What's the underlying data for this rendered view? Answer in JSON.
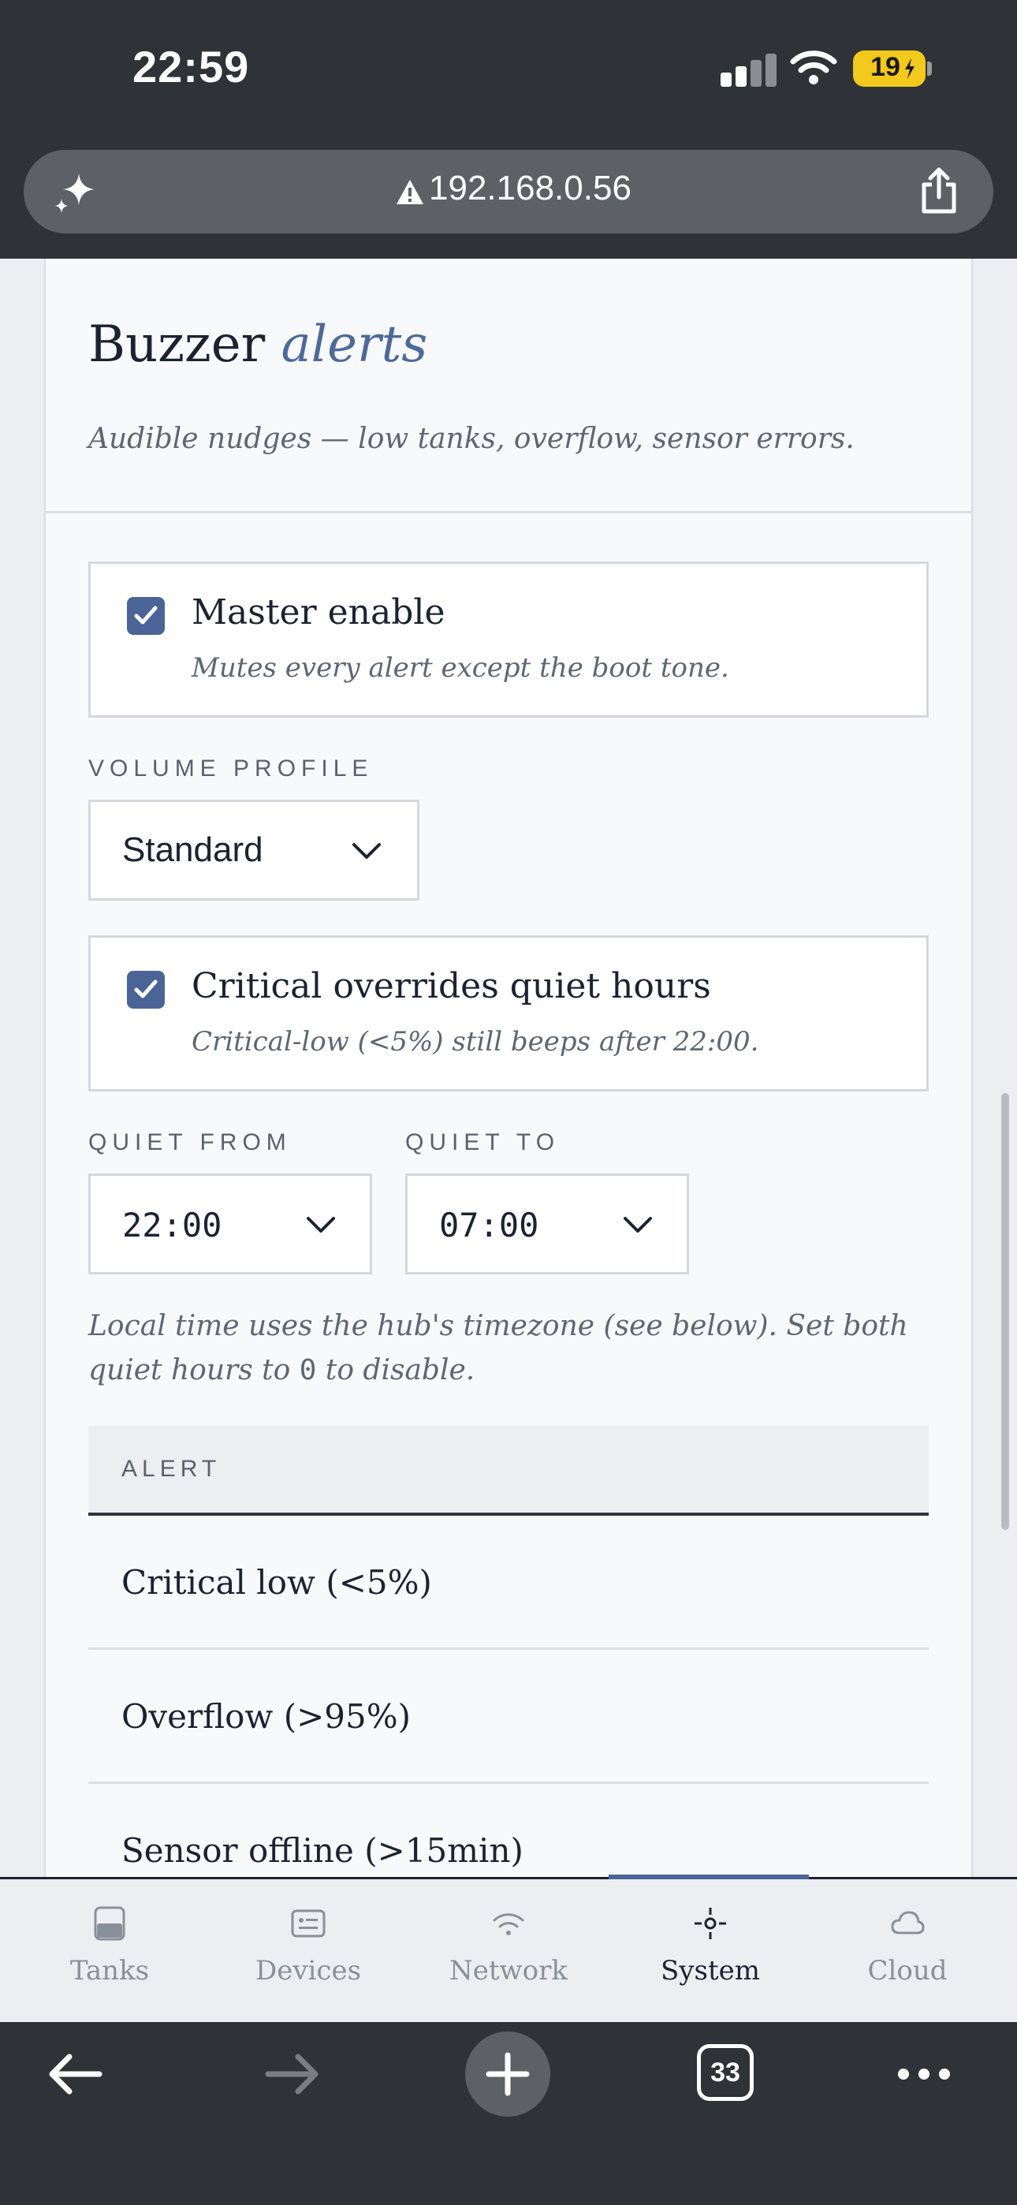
{
  "status_bar": {
    "time": "22:59",
    "battery": "19"
  },
  "browser": {
    "url": "192.168.0.56",
    "tab_count": "33"
  },
  "card": {
    "title": "Buzzer",
    "title_accent": "alerts",
    "subtitle": "Audible nudges — low tanks, overflow, sensor errors."
  },
  "master_enable": {
    "label": "Master enable",
    "description": "Mutes every alert except the boot tone.",
    "checked": true
  },
  "volume_profile": {
    "label": "VOLUME PROFILE",
    "value": "Standard"
  },
  "critical_override": {
    "label": "Critical overrides quiet hours",
    "description": "Critical-low (<5%) still beeps after 22:00.",
    "checked": true
  },
  "quiet_from": {
    "label": "QUIET FROM",
    "value": "22:00"
  },
  "quiet_to": {
    "label": "QUIET TO",
    "value": "07:00"
  },
  "help": {
    "text_before": "Local time uses the hub's timezone (see below). Set both quiet hours to ",
    "code": "0",
    "text_after": " to disable."
  },
  "alerts_table": {
    "header": "ALERT",
    "rows": [
      "Critical low (<5%)",
      "Overflow (>95%)",
      "Sensor offline (>15min)"
    ]
  },
  "tabbar": {
    "tabs": [
      {
        "label": "Tanks",
        "icon": "tank-icon"
      },
      {
        "label": "Devices",
        "icon": "device-card-icon"
      },
      {
        "label": "Network",
        "icon": "wifi-icon"
      },
      {
        "label": "System",
        "icon": "crosshair-icon",
        "active": true
      },
      {
        "label": "Cloud",
        "icon": "cloud-icon"
      }
    ]
  },
  "colors": {
    "accent": "#4a6498",
    "title_accent": "#4d6a9a",
    "battery": "#f2c91c",
    "chrome": "#2f3237"
  }
}
